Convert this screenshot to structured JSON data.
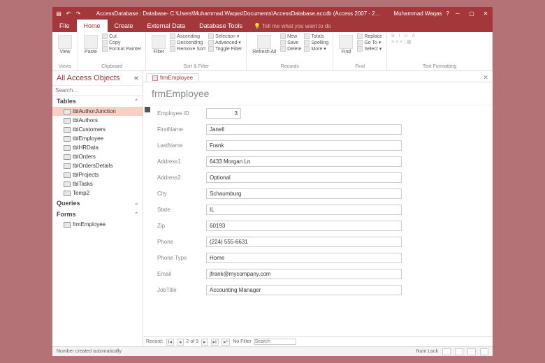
{
  "titlebar": {
    "title": "AccessDatabase : Database- C:\\Users\\Muhammad.Waqas\\Documents\\AccessDatabase.accdb (Access 2007 - 2…",
    "user": "Muhammad Waqas"
  },
  "menu": {
    "file": "File",
    "home": "Home",
    "create": "Create",
    "external": "External Data",
    "dbtools": "Database Tools",
    "tell": "Tell me what you want to do"
  },
  "ribbon": {
    "views": {
      "label": "Views",
      "view": "View"
    },
    "clipboard": {
      "label": "Clipboard",
      "paste": "Paste",
      "cut": "Cut",
      "copy": "Copy",
      "fp": "Format Painter"
    },
    "sortfilter": {
      "label": "Sort & Filter",
      "filter": "Filter",
      "asc": "Ascending",
      "desc": "Descending",
      "remove": "Remove Sort",
      "selection": "Selection ▾",
      "advanced": "Advanced ▾",
      "toggle": "Toggle Filter"
    },
    "records": {
      "label": "Records",
      "refresh": "Refresh All",
      "new": "New",
      "save": "Save",
      "delete": "Delete",
      "totals": "Totals",
      "spelling": "Spelling",
      "more": "More ▾"
    },
    "find": {
      "label": "Find",
      "find": "Find",
      "replace": "Replace",
      "goto": "Go To ▾",
      "select": "Select ▾"
    },
    "textfmt": {
      "label": "Text Formatting"
    }
  },
  "nav": {
    "header": "All Access Objects",
    "search": "Search…",
    "tables": "Tables",
    "queries": "Queries",
    "forms": "Forms",
    "items": [
      "tblAuthorJunction",
      "tblAuthors",
      "tblCustomers",
      "tblEmployee",
      "tblHRData",
      "tblOrders",
      "tblOrdersDetails",
      "tblProjects",
      "tblTasks",
      "Temp2"
    ],
    "formItems": [
      "frmEmployee"
    ]
  },
  "doctab": "frmEmployee",
  "formtitle": "frmEmployee",
  "fields": {
    "empid": {
      "label": "Employee ID",
      "value": "3"
    },
    "first": {
      "label": "FirstName",
      "value": "Janell"
    },
    "last": {
      "label": "LastName",
      "value": "Frank"
    },
    "addr1": {
      "label": "Address1",
      "value": "6433 Morgan Ln"
    },
    "addr2": {
      "label": "Address2",
      "value": "Optional"
    },
    "city": {
      "label": "City",
      "value": "Schaumburg"
    },
    "state": {
      "label": "State",
      "value": "IL"
    },
    "zip": {
      "label": "Zip",
      "value": "60193"
    },
    "phone": {
      "label": "Phone",
      "value": "(224) 555-6631"
    },
    "ptype": {
      "label": "Phone Type",
      "value": "Home"
    },
    "email": {
      "label": "Email",
      "value": "jfrank@mycompany.com"
    },
    "title": {
      "label": "JobTitle",
      "value": "Accounting Manager"
    }
  },
  "recnav": {
    "label": "Record:",
    "pos": "2 of 9",
    "nofilter": "No Filter",
    "search": "Search"
  },
  "status": {
    "left": "Number created automatically",
    "numlock": "Num Lock"
  }
}
